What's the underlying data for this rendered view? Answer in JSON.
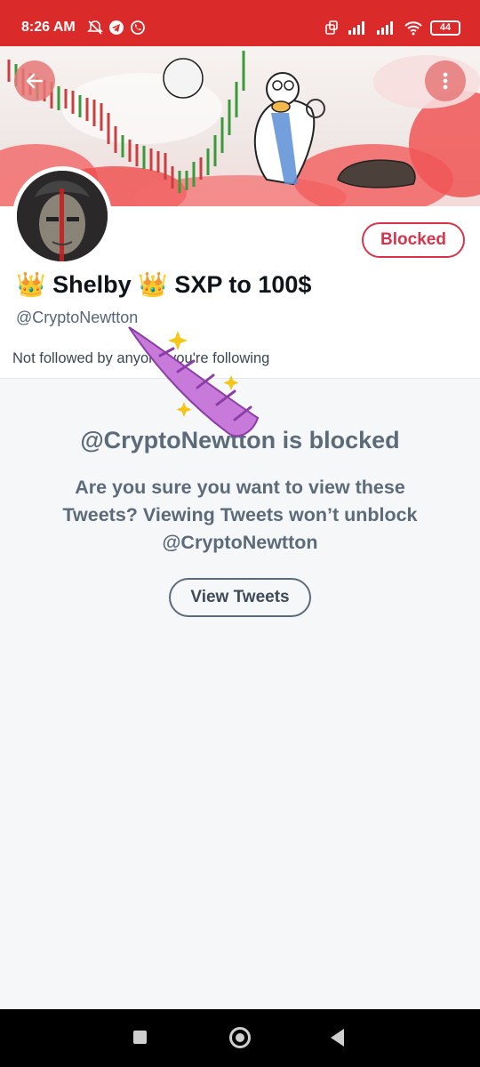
{
  "status_bar": {
    "time": "8:26 AM",
    "battery": "44",
    "left_icons": [
      "muted-bell-icon",
      "telegram-icon",
      "whatsapp-icon"
    ],
    "right_icons": [
      "screen-icon",
      "signal-icon",
      "signal-icon",
      "wifi-icon",
      "battery-icon"
    ],
    "color": "#db2a2a"
  },
  "header": {
    "back_icon": "arrow-left-icon",
    "more_icon": "more-vertical-icon"
  },
  "profile": {
    "blocked_label": "Blocked",
    "name_part1": "Shelby",
    "name_part2": "SXP to 100$",
    "crown_emoji": "👑",
    "handle": "@CryptoNewtton",
    "follow_note": "Not followed by anyone you're following",
    "accent_color": "#d9334b"
  },
  "blocked": {
    "title": "@CryptoNewtton is blocked",
    "message": "Are you sure you want to view these Tweets? Viewing Tweets won’t unblock @CryptoNewtton",
    "view_button": "View Tweets"
  },
  "nav": {
    "recents_icon": "square-icon",
    "home_icon": "circle-icon",
    "back_icon": "triangle-back-icon"
  }
}
